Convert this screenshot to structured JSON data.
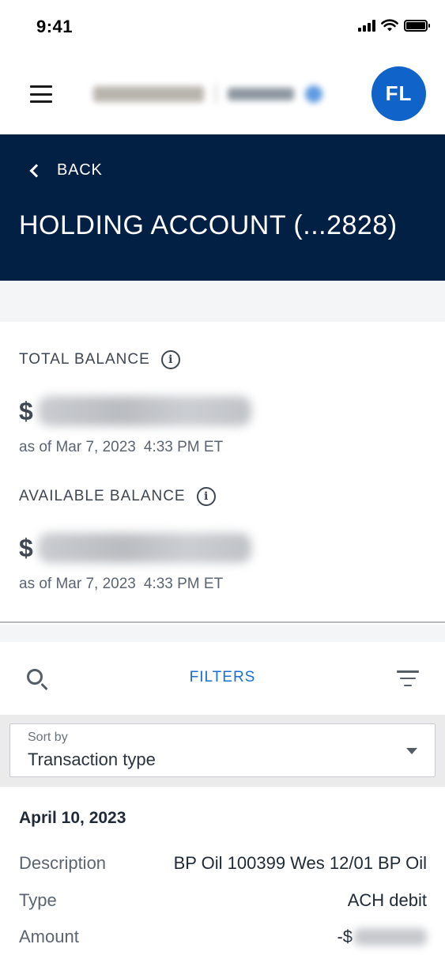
{
  "status_bar": {
    "time": "9:41"
  },
  "header": {
    "avatar_initials": "FL"
  },
  "banner": {
    "back_label": "BACK",
    "title": "HOLDING ACCOUNT (...2828)"
  },
  "balances": {
    "total": {
      "label": "TOTAL BALANCE",
      "currency_symbol": "$",
      "as_of_date": "as of Mar 7, 2023",
      "as_of_time": "4:33 PM ET"
    },
    "available": {
      "label": "AVAILABLE BALANCE",
      "currency_symbol": "$",
      "as_of_date": "as of Mar 7, 2023",
      "as_of_time": "4:33 PM ET"
    }
  },
  "toolbar": {
    "filters_label": "FILTERS"
  },
  "sort": {
    "label": "Sort by",
    "value": "Transaction type"
  },
  "transaction": {
    "date": "April 10, 2023",
    "rows": [
      {
        "key": "Description",
        "value": "BP Oil 100399 Wes 12/01 BP Oil"
      },
      {
        "key": "Type",
        "value": "ACH debit"
      },
      {
        "key": "Amount",
        "value": "-$"
      }
    ]
  },
  "colors": {
    "banner": "#021f44",
    "accent": "#1a6fd4",
    "avatar": "#1063c8"
  },
  "icons": [
    "hamburger-icon",
    "chevron-left-icon",
    "info-icon",
    "search-icon",
    "filter-icon",
    "caret-down-icon"
  ]
}
